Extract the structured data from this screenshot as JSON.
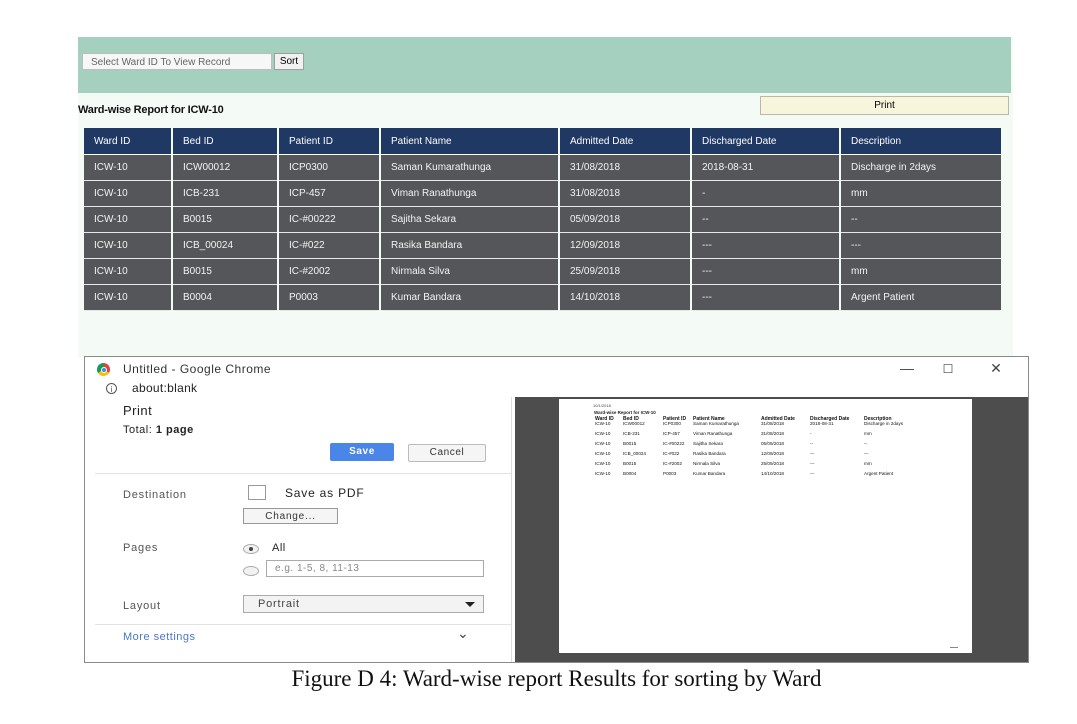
{
  "app": {
    "ward_select_placeholder": "Select Ward ID To View Record",
    "sort_label": "Sort",
    "report_title": "Ward-wise Report for ICW-10",
    "print_label": "Print",
    "columns": [
      "Ward ID",
      "Bed ID",
      "Patient ID",
      "Patient Name",
      "Admitted Date",
      "Discharged Date",
      "Description"
    ],
    "rows": [
      [
        "ICW-10",
        "ICW00012",
        "ICP0300",
        "Saman Kumarathunga",
        "31/08/2018",
        "2018-08-31",
        "Discharge in 2days"
      ],
      [
        "ICW-10",
        "ICB-231",
        "ICP-457",
        "Viman Ranathunga",
        "31/08/2018",
        "-",
        "mm"
      ],
      [
        "ICW-10",
        "B0015",
        "IC-#00222",
        "Sajitha Sekara",
        "05/09/2018",
        "--",
        "--"
      ],
      [
        "ICW-10",
        "ICB_00024",
        "IC-#022",
        "Rasika Bandara",
        "12/09/2018",
        "---",
        "---"
      ],
      [
        "ICW-10",
        "B0015",
        "IC-#2002",
        "Nirmala Silva",
        "25/09/2018",
        "---",
        "mm"
      ],
      [
        "ICW-10",
        "B0004",
        "P0003",
        "Kumar Bandara",
        "14/10/2018",
        "---",
        "Argent Patient"
      ]
    ]
  },
  "chrome": {
    "window_title": "Untitled - Google Chrome",
    "url": "about:blank",
    "minimize": "—",
    "maximize": "☐",
    "close": "✕",
    "info": "i"
  },
  "print_dialog": {
    "title": "Print",
    "total_label": "Total:",
    "total_value": "1 page",
    "save_label": "Save",
    "cancel_label": "Cancel",
    "destination_label": "Destination",
    "destination_value": "Save as PDF",
    "change_label": "Change...",
    "pages_label": "Pages",
    "pages_all": "All",
    "pages_range_placeholder": "e.g. 1-5, 8, 11-13",
    "layout_label": "Layout",
    "layout_value": "Portrait",
    "more_settings": "More settings",
    "more_chevron": "⌄"
  },
  "preview": {
    "date": "10/1/2018",
    "title": "Ward-wise Report for ICW-10",
    "columns": [
      "Ward ID",
      "Bed ID",
      "Patient ID",
      "Patient Name",
      "Admitted Date",
      "Discharged Date",
      "Description"
    ],
    "rows": [
      [
        "ICW-10",
        "ICW00012",
        "ICP0300",
        "Saman Kumarathunga",
        "31/08/2018",
        "2018-08-31",
        "Discharge in 2days"
      ],
      [
        "ICW-10",
        "ICB-231",
        "ICP-457",
        "Viman Ranathunga",
        "31/08/2018",
        "-",
        "mm"
      ],
      [
        "ICW-10",
        "B0015",
        "IC-#00222",
        "Sajitha Sekara",
        "05/09/2018",
        "--",
        "--"
      ],
      [
        "ICW-10",
        "ICB_00024",
        "IC-#022",
        "Rasika Bandara",
        "12/09/2018",
        "---",
        "---"
      ],
      [
        "ICW-10",
        "B0015",
        "IC-#2002",
        "Nirmala Silva",
        "25/09/2018",
        "---",
        "mm"
      ],
      [
        "ICW-10",
        "B0004",
        "P0003",
        "Kumar Bandara",
        "14/10/2018",
        "---",
        "Argent Patient"
      ]
    ]
  },
  "caption": "Figure D 4: Ward-wise report Results for sorting by Ward"
}
